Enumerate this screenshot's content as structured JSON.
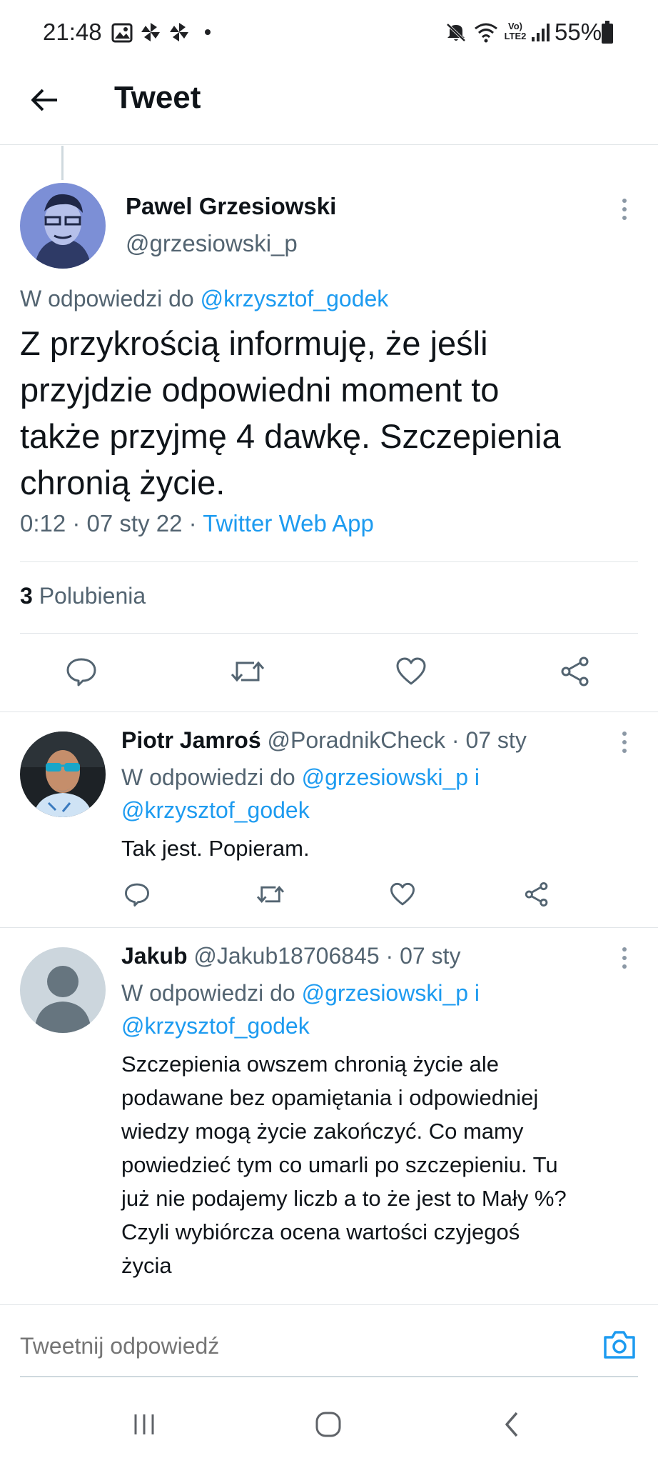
{
  "status_bar": {
    "time": "21:48",
    "network": "Vo) LTE2",
    "battery": "55%"
  },
  "header": {
    "title": "Tweet"
  },
  "main_tweet": {
    "display_name": "Pawel Grzesiowski",
    "handle": "@grzesiowski_p",
    "replying_prefix": "W odpowiedzi do",
    "replying_to": "@krzysztof_godek",
    "text_lines": [
      "Z przykrością informuję, że jeśli",
      "przyjdzie odpowiedni moment  to",
      "także przyjmę 4 dawkę. Szczepienia",
      "chronią życie."
    ],
    "time": "0:12 · 07 sty 22 ·",
    "source": "Twitter Web App",
    "likes_count": "3",
    "likes_label": "Polubienia"
  },
  "replies": [
    {
      "display_name": "Piotr Jamroś",
      "handle": "@PoradnikCheck",
      "date": "· 07 sty",
      "replying_prefix": "W odpowiedzi do",
      "replying_to_1": "@grzesiowski_p",
      "conjunction": "i",
      "replying_to_2": "@krzysztof_godek",
      "text_lines": [
        "Tak jest. Popieram."
      ]
    },
    {
      "display_name": "Jakub",
      "handle": "@Jakub18706845",
      "date": "· 07 sty",
      "replying_prefix": "W odpowiedzi do",
      "replying_to_1": "@grzesiowski_p",
      "conjunction": "i",
      "replying_to_2": "@krzysztof_godek",
      "text_lines": [
        "Szczepienia owszem chronią życie ale",
        "podawane bez opamiętania i odpowiedniej",
        "wiedzy mogą życie zakończyć. Co mamy",
        "powiedzieć tym co umarli po szczepieniu. Tu",
        "już nie podajemy liczb a to że jest to Mały %?",
        "Czyli wybiórcza ocena wartości czyjegoś",
        "życia"
      ]
    }
  ],
  "composer": {
    "placeholder": "Tweetnij odpowiedź"
  },
  "colors": {
    "accent": "#1d9bf0",
    "secondary_text": "#536471",
    "divider": "#e1e5e8"
  },
  "icons": {
    "status": [
      "gallery-icon",
      "pinwheel-icon",
      "pinwheel-icon",
      "dot-icon",
      "mute-icon",
      "wifi-icon",
      "signal-icon",
      "battery-icon"
    ],
    "actions": [
      "reply-icon",
      "retweet-icon",
      "like-icon",
      "share-icon"
    ],
    "nav": [
      "recent-apps-icon",
      "home-icon",
      "back-icon"
    ]
  }
}
